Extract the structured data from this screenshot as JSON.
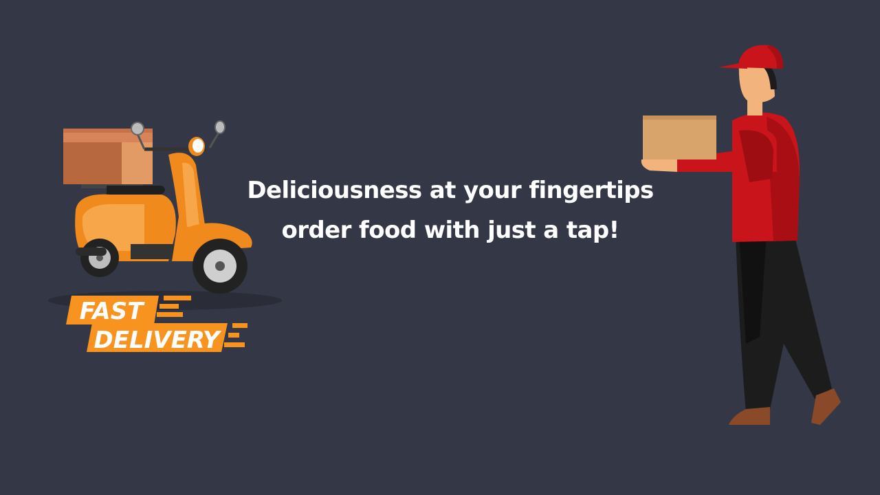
{
  "headline": {
    "line1": "Deliciousness at your fingertips",
    "line2": "order food with just a tap!"
  },
  "badge": {
    "word1": "FAST",
    "word2": "DELIVERY",
    "color": "#f7931e"
  },
  "colors": {
    "background": "#343846",
    "text": "#ffffff",
    "scooter": "#f28c1a",
    "courier_shirt": "#c8141a",
    "courier_pants": "#1b1b1b",
    "box": "#d9a46c"
  },
  "illustrations": {
    "scooter": "scooter-with-box-illustration",
    "courier": "delivery-person-holding-box-illustration"
  }
}
